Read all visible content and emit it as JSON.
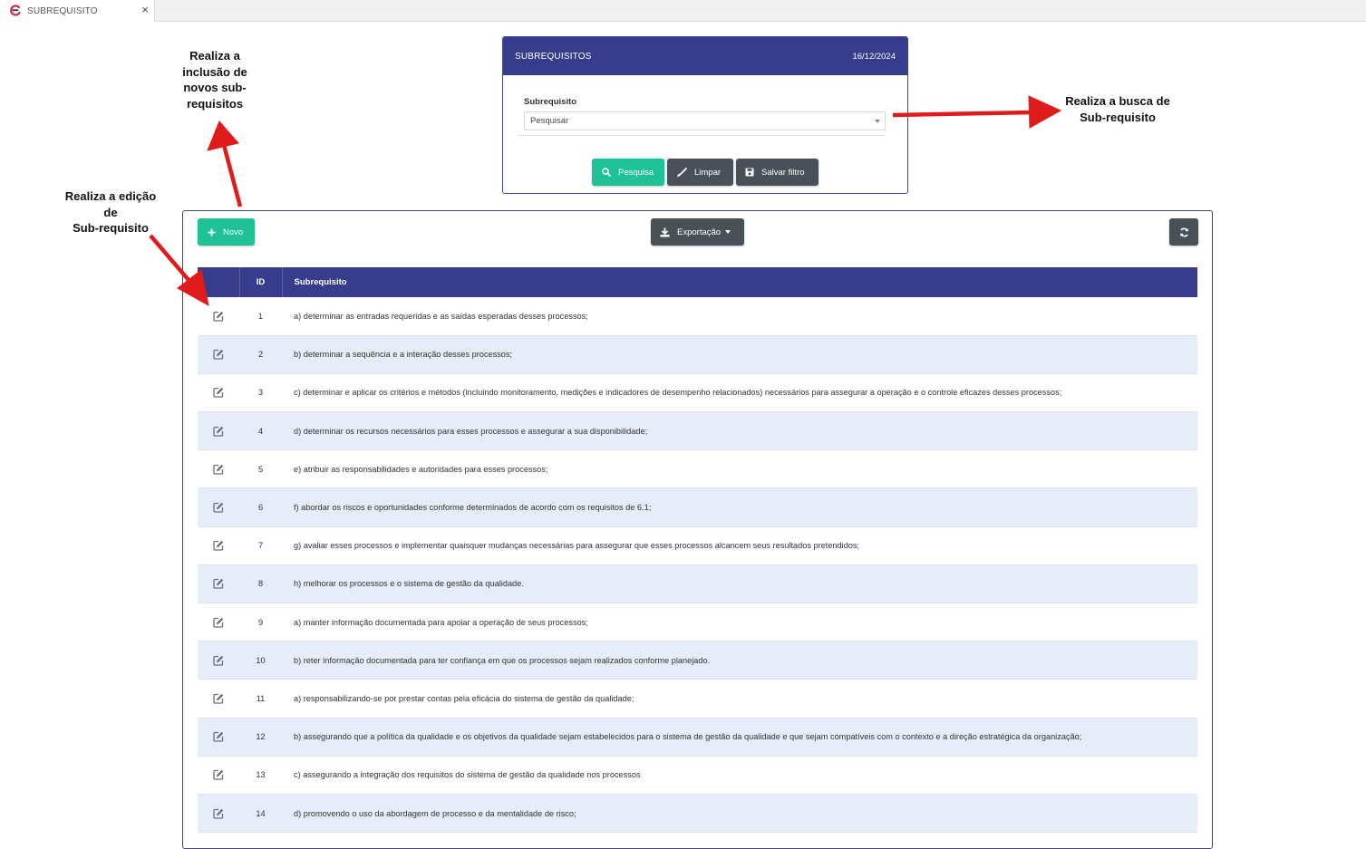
{
  "tab": {
    "title": "SUBREQUISITO",
    "close": "×"
  },
  "filter": {
    "title": "SUBREQUISITOS",
    "date": "16/12/2024",
    "field_label": "Subrequisito",
    "select_value": "Pesquisar",
    "buttons": {
      "search": "Pesquisa",
      "clear": "Limpar",
      "save_filter": "Salvar filtro"
    },
    "colors": {
      "header": "#363d8c",
      "search": "#1fc296",
      "neutral": "#4a5058"
    }
  },
  "toolbar": {
    "new_label": "Novo",
    "export_label": "Exportação"
  },
  "table": {
    "headers": {
      "action": "",
      "id": "ID",
      "text": "Subrequisito"
    },
    "rows": [
      {
        "id": "1",
        "text": "a) determinar as entradas requeridas e as saídas esperadas desses processos;"
      },
      {
        "id": "2",
        "text": "b) determinar a sequência e a interação desses processos;"
      },
      {
        "id": "3",
        "text": "c) determinar e aplicar os critérios e métodos (incluindo monitoramento, medições e indicadores de desempenho relacionados) necessários para assegurar a operação e o controle eficazes desses processos;"
      },
      {
        "id": "4",
        "text": "d) determinar os recursos necessários para esses processos e assegurar a sua disponibilidade;"
      },
      {
        "id": "5",
        "text": "e) atribuir as responsabilidades e autoridades para esses processos;"
      },
      {
        "id": "6",
        "text": "f) abordar os riscos e oportunidades conforme determinados de acordo com os requisitos de 6.1;"
      },
      {
        "id": "7",
        "text": "g) avaliar esses processos e implementar quaisquer mudanças necessárias para assegurar que esses processos alcancem seus resultados pretendidos;"
      },
      {
        "id": "8",
        "text": "h) melhorar os processos e o sistema de gestão da qualidade."
      },
      {
        "id": "9",
        "text": "a) manter informação documentada para apoiar a operação de seus processos;"
      },
      {
        "id": "10",
        "text": "b) reter informação documentada para ter confiança em que os processos sejam realizados conforme planejado."
      },
      {
        "id": "11",
        "text": "a) responsabilizando-se por prestar contas pela eficácia do sistema de gestão da qualidade;"
      },
      {
        "id": "12",
        "text": "b) assegurando que a política da qualidade e os objetivos da qualidade sejam estabelecidos para o sistema de gestão da qualidade e que sejam compatíveis com o contexto e a direção estratégica da organização;"
      },
      {
        "id": "13",
        "text": "c) assegurando a integração dos requisitos do sistema de gestão da qualidade nos processos"
      },
      {
        "id": "14",
        "text": "d) promovendo o uso da abordagem de processo e da mentalidade de risco;"
      }
    ],
    "colors": {
      "header": "#363d8c",
      "stripe": "#e6edf8"
    }
  },
  "annotations": {
    "new_note": "Realiza a\ninclusão de\nnovos sub-\nrequisitos",
    "edit_note": "Realiza a edição\nde\nSub-requisito",
    "search_note": "Realiza a busca de\nSub-requisito",
    "arrow_color": "#e01b1b"
  },
  "icons": {
    "tab_logo": "logo-icon",
    "search": "search-icon",
    "clear": "brush-icon",
    "save": "save-icon",
    "new": "plus-icon",
    "export": "download-icon",
    "refresh": "refresh-icon",
    "edit": "edit-icon"
  }
}
